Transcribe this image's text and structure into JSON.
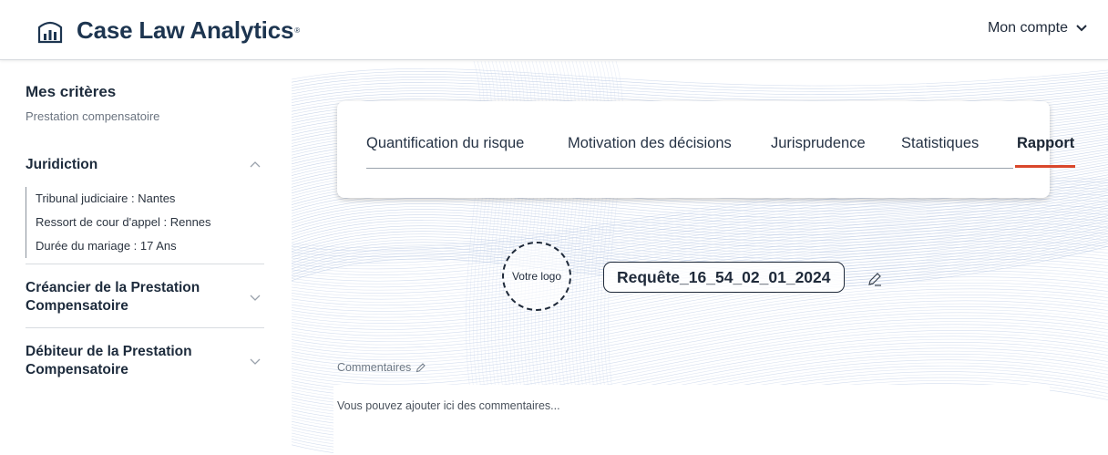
{
  "header": {
    "brand_name": "Case Law Analytics",
    "brand_mark": "®",
    "account_label": "Mon compte",
    "colors": {
      "brand": "#1d3550",
      "accent": "#d9472b"
    }
  },
  "sidebar": {
    "title": "Mes critères",
    "subtitle": "Prestation compensatoire",
    "sections": [
      {
        "title": "Juridiction",
        "expanded": true,
        "items": [
          "Tribunal judiciaire : Nantes",
          "Ressort de cour d'appel : Rennes",
          "Durée du mariage : 17 Ans"
        ]
      },
      {
        "title_line1": "Créancier de la Prestation",
        "title_line2": "Compensatoire",
        "expanded": false
      },
      {
        "title_line1": "Débiteur de la Prestation",
        "title_line2": "Compensatoire",
        "expanded": false
      }
    ]
  },
  "tabs": {
    "items": [
      "Quantification du risque",
      "Motivation des décisions",
      "Jurisprudence",
      "Statistiques",
      "Rapport"
    ],
    "active": "Rapport"
  },
  "report": {
    "logo_placeholder": "Votre logo",
    "request_name": "Requête_16_54_02_01_2024",
    "comments_label": "Commentaires",
    "comments_placeholder": "Vous pouvez ajouter ici des commentaires..."
  }
}
